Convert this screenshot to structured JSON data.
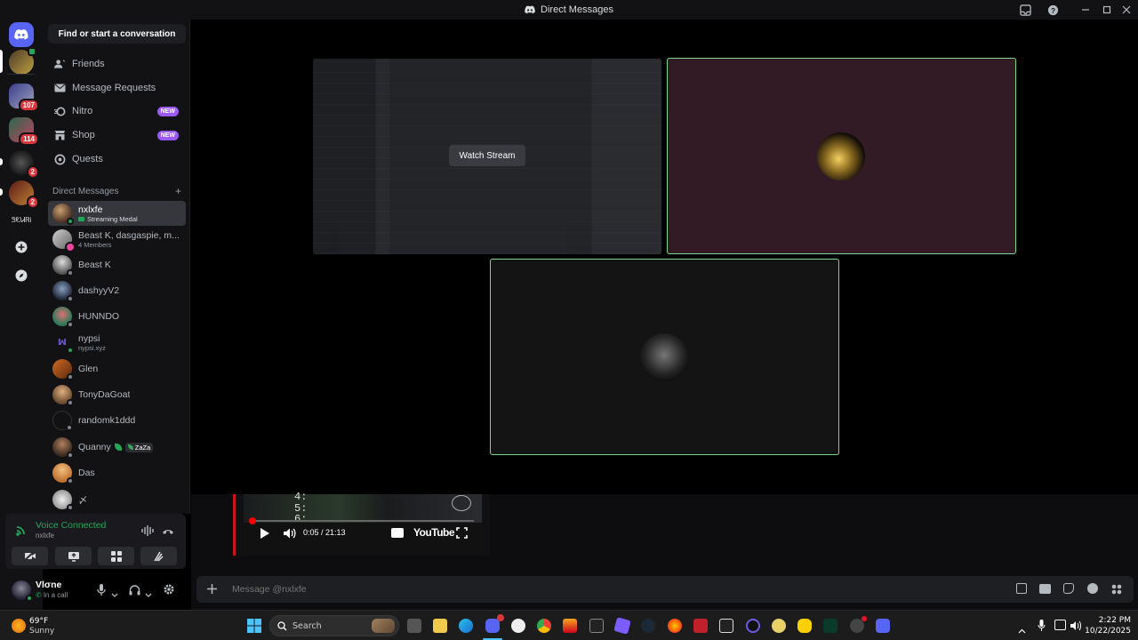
{
  "window": {
    "title": "Direct Messages"
  },
  "servers": [
    {
      "name": "Discord Home"
    },
    {
      "name": "server-1"
    },
    {
      "name": "server-2",
      "badge": "107"
    },
    {
      "name": "server-3",
      "badge": "114"
    },
    {
      "name": "server-4",
      "badge": "2"
    },
    {
      "name": "server-5",
      "badge": "2"
    },
    {
      "name": "server-6",
      "label": "ᏕᎧᏗᏒᎥ"
    },
    {
      "name": "add-server"
    },
    {
      "name": "discover"
    }
  ],
  "sidebar": {
    "search_label": "Find or start a conversation",
    "nav": [
      {
        "label": "Friends",
        "icon": "friends-icon"
      },
      {
        "label": "Message Requests",
        "icon": "mail-icon"
      },
      {
        "label": "Nitro",
        "icon": "nitro-icon",
        "badge": "NEW"
      },
      {
        "label": "Shop",
        "icon": "shop-icon",
        "badge": "NEW"
      },
      {
        "label": "Quests",
        "icon": "quests-icon"
      }
    ],
    "dm_header": "Direct Messages",
    "dm_add": "+",
    "dms": [
      {
        "name": "nxlxfe",
        "sub": "Streaming Medal",
        "color": "#6b4f3a",
        "status": "#23a55a",
        "active": true
      },
      {
        "name": "Beast K, dasgaspie, m...",
        "sub": "4 Members",
        "color": "#5865f2"
      },
      {
        "name": "Beast K",
        "color": "#8a8a8a"
      },
      {
        "name": "dashyyV2",
        "color": "#3a5a7a"
      },
      {
        "name": "HUNNDO",
        "color": "#3f8f6a"
      },
      {
        "name": "nypsi",
        "sub": "nypsi.xyz",
        "color": "#2a2060",
        "status": "#23a55a"
      },
      {
        "name": "Glen",
        "color": "#a0522d"
      },
      {
        "name": "TonyDaGoat",
        "color": "#c08a5a"
      },
      {
        "name": "randomk1ddd",
        "color": "#1e1f22"
      },
      {
        "name": "Quanny",
        "tag": "ZaZa",
        "color": "#6a5040"
      },
      {
        "name": "Das",
        "color": "#d08a40"
      },
      {
        "name": "〆",
        "color": "#d0d0d0"
      }
    ]
  },
  "voice": {
    "status": "Voice Connected",
    "channel": "nxlxfe"
  },
  "user": {
    "name": "Vlσne",
    "status": "In a call"
  },
  "stage": {
    "watch_stream_label": "Watch Stream"
  },
  "youtube_mini": {
    "lines": [
      "4:",
      "5:",
      "6:"
    ],
    "time": "0:05 / 21:13",
    "brand": "YouTube",
    "progress": 0.004
  },
  "composer": {
    "placeholder": "Message @nxlxfe"
  },
  "taskbar": {
    "weather_temp": "69°F",
    "weather_desc": "Sunny",
    "search_label": "Search",
    "time": "2:22 PM",
    "date": "10/22/2025"
  }
}
